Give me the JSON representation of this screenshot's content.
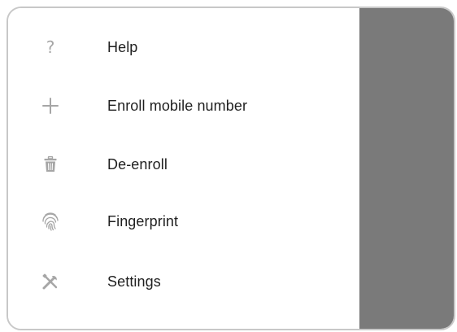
{
  "drawer": {
    "items": [
      {
        "id": "help",
        "label": "Help",
        "icon": "help-icon",
        "glyph": "?"
      },
      {
        "id": "enroll",
        "label": "Enroll mobile number",
        "icon": "plus-icon"
      },
      {
        "id": "deenroll",
        "label": "De-enroll",
        "icon": "trash-icon"
      },
      {
        "id": "fingerprint",
        "label": "Fingerprint",
        "icon": "fingerprint-icon"
      },
      {
        "id": "settings",
        "label": "Settings",
        "icon": "tools-icon"
      }
    ]
  },
  "colors": {
    "icon": "#a6a6a6",
    "text": "#1f1f1f",
    "scrim": "#7a7a7a",
    "border": "#c8c8c8"
  }
}
